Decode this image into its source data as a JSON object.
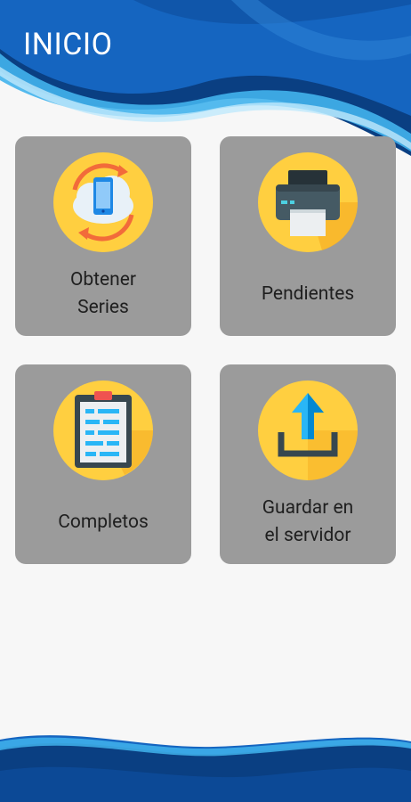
{
  "header": {
    "title": "INICIO"
  },
  "tiles": [
    {
      "line1": "Obtener",
      "line2": "Series",
      "icon": "sync-phone-icon"
    },
    {
      "line1": "Pendientes",
      "icon": "printer-icon"
    },
    {
      "line1": "Completos",
      "icon": "clipboard-icon"
    },
    {
      "line1": "Guardar en",
      "line2": "el servidor",
      "icon": "upload-icon"
    }
  ],
  "colors": {
    "wave_dark": "#0a3f82",
    "wave_mid": "#1565c0",
    "wave_light": "#41b3ec",
    "tile_bg": "#9b9b9b",
    "icon_circle": "#ffcf40"
  }
}
